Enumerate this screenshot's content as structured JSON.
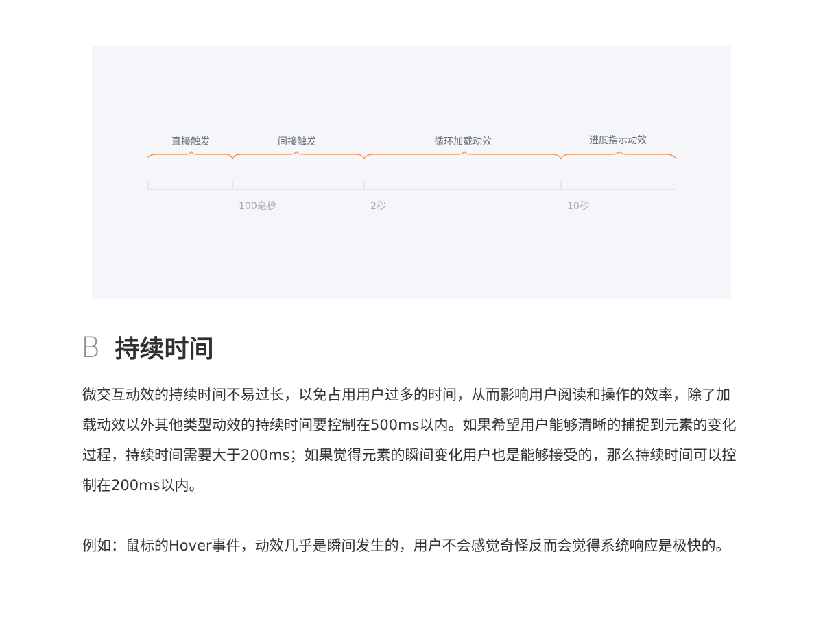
{
  "diagram": {
    "segments": [
      {
        "label": "直接触发"
      },
      {
        "label": "间接触发"
      },
      {
        "label": "循环加载动效"
      },
      {
        "label": "进度指示动效"
      }
    ],
    "ticks": [
      {
        "label": "100毫秒"
      },
      {
        "label": "2秒"
      },
      {
        "label": "10秒"
      }
    ],
    "colors": {
      "brace": "#f08a4b",
      "axis": "#d9dbe0",
      "background": "#f5f6fa"
    }
  },
  "section": {
    "letter": "B",
    "title": "持续时间"
  },
  "paragraphs": {
    "p1": "微交互动效的持续时间不易过长，以免占用用户过多的时间，从而影响用户阅读和操作的效率，除了加载动效以外其他类型动效的持续时间要控制在500ms以内。如果希望用户能够清晰的捕捉到元素的变化过程，持续时间需要大于200ms；如果觉得元素的瞬间变化用户也是能够接受的，那么持续时间可以控制在200ms以内。",
    "p2": "例如：鼠标的Hover事件，动效几乎是瞬间发生的，用户不会感觉奇怪反而会觉得系统响应是极快的。"
  }
}
